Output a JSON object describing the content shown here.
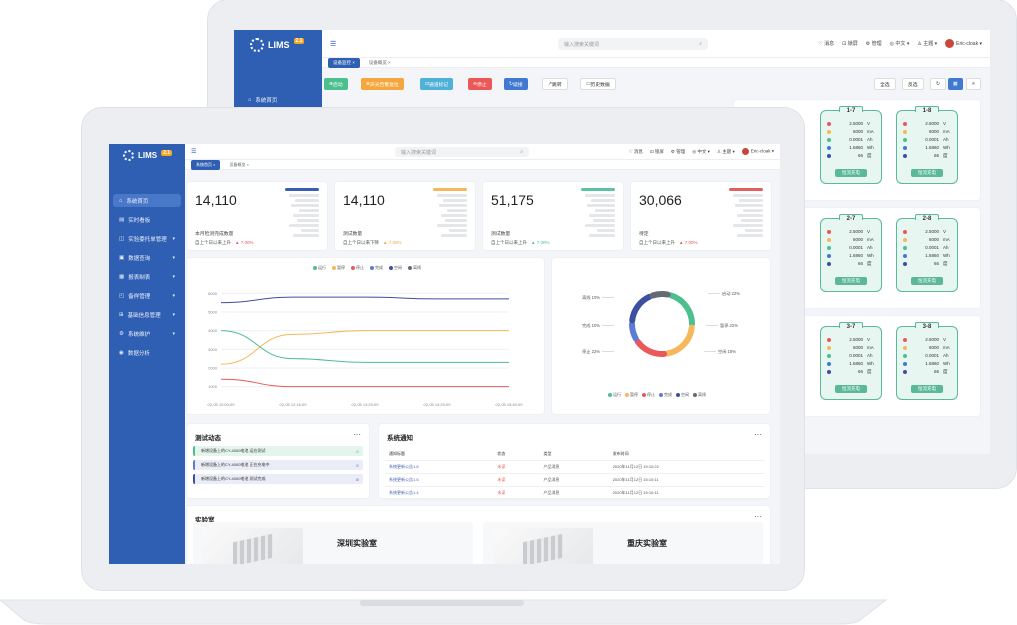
{
  "back": {
    "app": {
      "name": "LIMS",
      "version": "2.1"
    },
    "search_placeholder": "输入搜索关键词",
    "tools": [
      "消息",
      "锁屏",
      "管理",
      "中文",
      "主题"
    ],
    "user": "Eric-cloak",
    "tabs": [
      {
        "label": "设备监控",
        "active": true
      },
      {
        "label": "设备概览",
        "active": false
      }
    ],
    "nav": [
      {
        "label": "系统首页"
      }
    ],
    "buttons": [
      {
        "label": "启动",
        "color": "#4cbf8f"
      },
      {
        "label": "声光告警复位",
        "color": "#f5a63c"
      },
      {
        "label": "通道标记",
        "color": "#4fb0d8"
      },
      {
        "label": "停止",
        "color": "#ea5858"
      },
      {
        "label": "续接",
        "color": "#3f7ad0"
      }
    ],
    "outline_buttons": [
      "跳转",
      "历史数据"
    ],
    "right_buttons": [
      "全选",
      "反选"
    ],
    "batteries": [
      {
        "name": "1-7",
        "values": [
          "2.5000",
          "6000",
          "0.0001",
          "1.6860",
          "66"
        ],
        "units": [
          "V",
          "mA",
          "Ah",
          "Wh",
          "度"
        ],
        "status": "恒流充电"
      },
      {
        "name": "1-8",
        "values": [
          "2.5000",
          "6000",
          "0.0001",
          "1.6860",
          "66"
        ],
        "units": [
          "V",
          "mA",
          "Ah",
          "Wh",
          "度"
        ],
        "status": "恒流充电"
      },
      {
        "name": "2-7",
        "values": [
          "2.5000",
          "6000",
          "0.0001",
          "1.6860",
          "66"
        ],
        "units": [
          "V",
          "mA",
          "Ah",
          "Wh",
          "度"
        ],
        "status": "恒流充电"
      },
      {
        "name": "2-8",
        "values": [
          "2.5000",
          "6000",
          "0.0001",
          "1.6860",
          "66"
        ],
        "units": [
          "V",
          "mA",
          "Ah",
          "Wh",
          "度"
        ],
        "status": "恒流充电"
      },
      {
        "name": "3-7",
        "values": [
          "2.5000",
          "6000",
          "0.0001",
          "1.6860",
          "66"
        ],
        "units": [
          "V",
          "mA",
          "Ah",
          "Wh",
          "度"
        ],
        "status": "恒流充电"
      },
      {
        "name": "3-8",
        "values": [
          "2.5000",
          "6000",
          "0.0001",
          "1.6860",
          "66"
        ],
        "units": [
          "V",
          "mA",
          "Ah",
          "Wh",
          "度"
        ],
        "status": "恒流充电"
      }
    ]
  },
  "front": {
    "app": {
      "name": "LIMS",
      "version": "2.1"
    },
    "search_placeholder": "输入搜索关键词",
    "tools": [
      "消息",
      "锁屏",
      "管理",
      "中文",
      "主题"
    ],
    "user": "Eric-cloak",
    "tabs": [
      {
        "label": "系统首页",
        "active": true
      },
      {
        "label": "设备概览",
        "active": false
      }
    ],
    "nav": [
      {
        "label": "系统首页",
        "active": true,
        "chev": false
      },
      {
        "label": "实时看板",
        "chev": false
      },
      {
        "label": "实验委托单管理",
        "chev": true
      },
      {
        "label": "数据查询",
        "chev": true
      },
      {
        "label": "报表制表",
        "chev": true
      },
      {
        "label": "备样管理",
        "chev": true
      },
      {
        "label": "基础信息管理",
        "chev": true
      },
      {
        "label": "系统维护",
        "chev": true
      },
      {
        "label": "数据分析",
        "chev": false
      }
    ],
    "kpis": [
      {
        "value": "14,110",
        "label": "本月检测完成数量",
        "compare": "自上个日以来上升",
        "trend": "▲ 7.00%",
        "trend_color": "#ea5858",
        "bar_color": "#3b5fae"
      },
      {
        "value": "14,110",
        "label": "测试数量",
        "compare": "自上个日以来下降",
        "trend": "▲ 7.00%",
        "trend_color": "#f5a63c",
        "bar_color": "#f5b85a"
      },
      {
        "value": "51,175",
        "label": "测试数量",
        "compare": "自上个日以来上升",
        "trend": "▲ 7.00%",
        "trend_color": "#4cbf8f",
        "bar_color": "#5bc2a3"
      },
      {
        "value": "30,066",
        "label": "待定",
        "compare": "自上个日以来上升",
        "trend": "▲ 7.00%",
        "trend_color": "#ea5858",
        "bar_color": "#e06060"
      }
    ],
    "legend": [
      {
        "label": "运行",
        "color": "#4cbf8f"
      },
      {
        "label": "暂停",
        "color": "#f5b85a"
      },
      {
        "label": "停止",
        "color": "#ea5858"
      },
      {
        "label": "完成",
        "color": "#5b7bd5"
      },
      {
        "label": "空闲",
        "color": "#3f4fa0"
      },
      {
        "label": "离线",
        "color": "#666a73"
      }
    ],
    "chart_data": [
      {
        "type": "line",
        "x": [
          "02-05 10:00:00",
          "02-05 12:16:00",
          "02-05 13:20:00",
          "02-05 14:20:00",
          "02-05 15:40:00"
        ],
        "yticks": [
          "1000",
          "2000",
          "3000",
          "4000",
          "5000",
          "6000"
        ],
        "ylim": [
          500,
          6500
        ],
        "series": [
          {
            "name": "空闲",
            "color": "#3f4fa0",
            "values": [
              5500,
              5800,
              5800,
              5700,
              5700
            ]
          },
          {
            "name": "暂停",
            "color": "#f5b85a",
            "values": [
              2200,
              3800,
              4000,
              4000,
              4000
            ]
          },
          {
            "name": "运行",
            "color": "#4cbf8f",
            "values": [
              4000,
              2500,
              2300,
              2300,
              2300
            ]
          },
          {
            "name": "停止",
            "color": "#ea5858",
            "values": [
              1400,
              1000,
              1000,
              1000,
              1000
            ]
          }
        ]
      },
      {
        "type": "pie",
        "labels": [
          "运行",
          "暂停",
          "停止",
          "完成",
          "空闲",
          "离线"
        ],
        "values": [
          22,
          22,
          18,
          10,
          18,
          10
        ],
        "callouts": [
          "启动 22%",
          "暂停 22%",
          "空闲 18%",
          "停止 22%",
          "完成 10%",
          "离线 10%"
        ],
        "colors": [
          "#4cbf8f",
          "#f5b85a",
          "#ea5858",
          "#5b7bd5",
          "#3f4fa0",
          "#666a73"
        ]
      }
    ],
    "activity": {
      "title": "测试动态",
      "items": [
        {
          "text": "新增设备上的CY-4000电池 运在测试",
          "bg": "#e4f5ee",
          "bar": "#4cbf8f"
        },
        {
          "text": "新增设备上的CY-4000电池 正在充电中",
          "bg": "#eaecf7",
          "bar": "#5b7bd5"
        },
        {
          "text": "新增设备上的CY-4000电池 测试完成",
          "bg": "#eaecf7",
          "bar": "#3f4fa0"
        }
      ]
    },
    "notice": {
      "title": "系统通知",
      "columns": [
        "通知标题",
        "状态",
        "类型",
        "发布时间"
      ],
      "rows": [
        [
          "系统更新公告1.6",
          "未读",
          "产品消息",
          "2020年11月12日 15:10:22"
        ],
        [
          "系统更新公告1.5",
          "未读",
          "产品消息",
          "2020年11月12日 15:10:11"
        ],
        [
          "系统更新公告1.4",
          "未读",
          "产品消息",
          "2020年11月12日 15:10:11"
        ]
      ]
    },
    "lab": {
      "title": "实验室",
      "items": [
        "深圳实验室",
        "重庆实验室"
      ]
    }
  }
}
